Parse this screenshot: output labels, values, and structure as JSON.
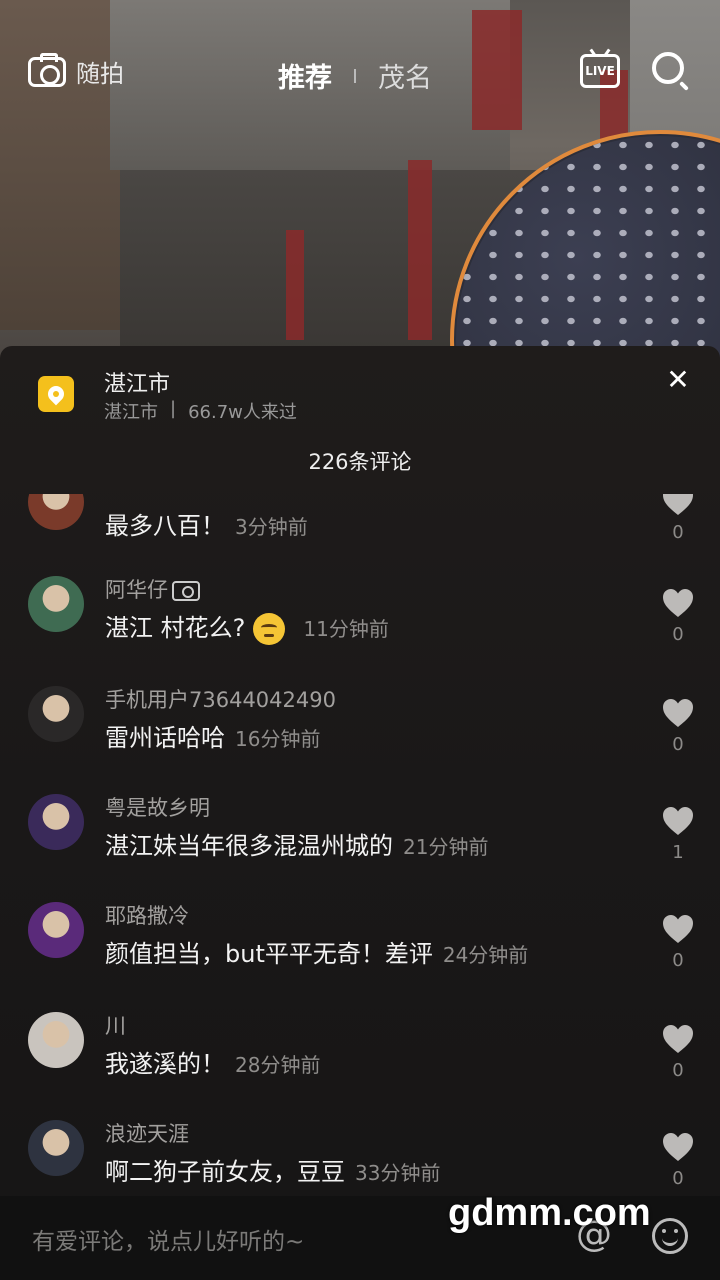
{
  "topbar": {
    "camera_label": "随拍",
    "tab_active": "推荐",
    "tab_inactive": "茂名",
    "live_label": "LIVE"
  },
  "location": {
    "title": "湛江市",
    "subtitle_city": "湛江市",
    "subtitle_sep": "|",
    "visitors": "66.7w人来过"
  },
  "comments_count_label": "226条评论",
  "comments": [
    {
      "user": "",
      "text": "最多八百！",
      "time": "3分钟前",
      "likes": "0",
      "avatar_color": "#7a3a2a"
    },
    {
      "user": "阿华仔",
      "text": "湛江 村花么?",
      "time": "11分钟前",
      "likes": "0",
      "avatar_color": "#3f6b52",
      "emoji": "thinking-face-icon",
      "user_badge": "camera-icon"
    },
    {
      "user": "手机用户73644042490",
      "text": "雷州话哈哈",
      "time": "16分钟前",
      "likes": "0",
      "avatar_color": "#2a2828"
    },
    {
      "user": "粤是故乡明",
      "text": "湛江妹当年很多混温州城的",
      "time": "21分钟前",
      "likes": "1",
      "avatar_color": "#3a2a5a"
    },
    {
      "user": "耶路撒冷",
      "text": "颜值担当，but平平无奇！差评",
      "time": "24分钟前",
      "likes": "0",
      "avatar_color": "#5a2a7a"
    },
    {
      "user": "川",
      "text": "我遂溪的！",
      "time": "28分钟前",
      "likes": "0",
      "avatar_color": "#c9c4be"
    },
    {
      "user": "浪迹天涯",
      "text": "啊二狗子前女友，豆豆",
      "time": "33分钟前",
      "likes": "0",
      "avatar_color": "#2e3340"
    }
  ],
  "input": {
    "placeholder": "有爱评论，说点儿好听的~"
  },
  "watermark": "gdmm.com",
  "colors": {
    "location_badge": "#f4c01c",
    "panel_bg": "#1c1a19",
    "secondary_text": "#8f8d8b"
  }
}
